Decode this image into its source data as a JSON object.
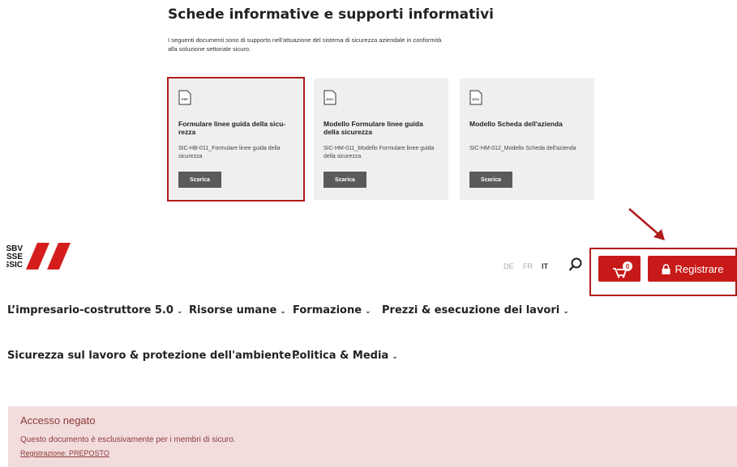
{
  "documents": {
    "title": "Schede informative e supporti informativi",
    "intro": "I seguenti documenti sono di supporto nell'attuazione del sistema di sicurezza aziendale in conformità alla soluzione settoriale sicuro.",
    "cards": [
      {
        "icon_label": "PDF",
        "title": "Formulare linee guida della sicu-rezza",
        "desc": "SIC-HB-011_Formulare linee guida della sicurezza",
        "button": "Scarica"
      },
      {
        "icon_label": "DOC",
        "title": "Modello Formulare linee guida della sicurezza",
        "desc": "SIC-HM-011_Modello Formulare linee guida della sicurezza",
        "button": "Scarica"
      },
      {
        "icon_label": "DOC",
        "title": "Modello Scheda dell'azienda",
        "desc": "SIC-HM-012_Modello Scheda dell'azienda",
        "button": "Scarica"
      }
    ]
  },
  "header": {
    "logo_lines": [
      "SBV",
      "SSE",
      "SSIC"
    ],
    "languages": [
      "DE",
      "FR",
      "IT"
    ],
    "active_language": "IT",
    "cart_count": "0",
    "register_label": "Registrare",
    "accent_color": "#c81919"
  },
  "nav": {
    "items": [
      "L’impresario-costruttore 5.0",
      "Risorse umane",
      "Formazione",
      "Prezzi & esecuzione dei lavori",
      "Sicurezza sul lavoro & protezione dell'ambiente",
      "Politica & Media"
    ],
    "chevron": "⌄"
  },
  "alert": {
    "heading": "Accesso negato",
    "message": "Questo documento è esclusivamente per i membri di sicuro.",
    "link": "Registrazione: PREPOSTO"
  }
}
